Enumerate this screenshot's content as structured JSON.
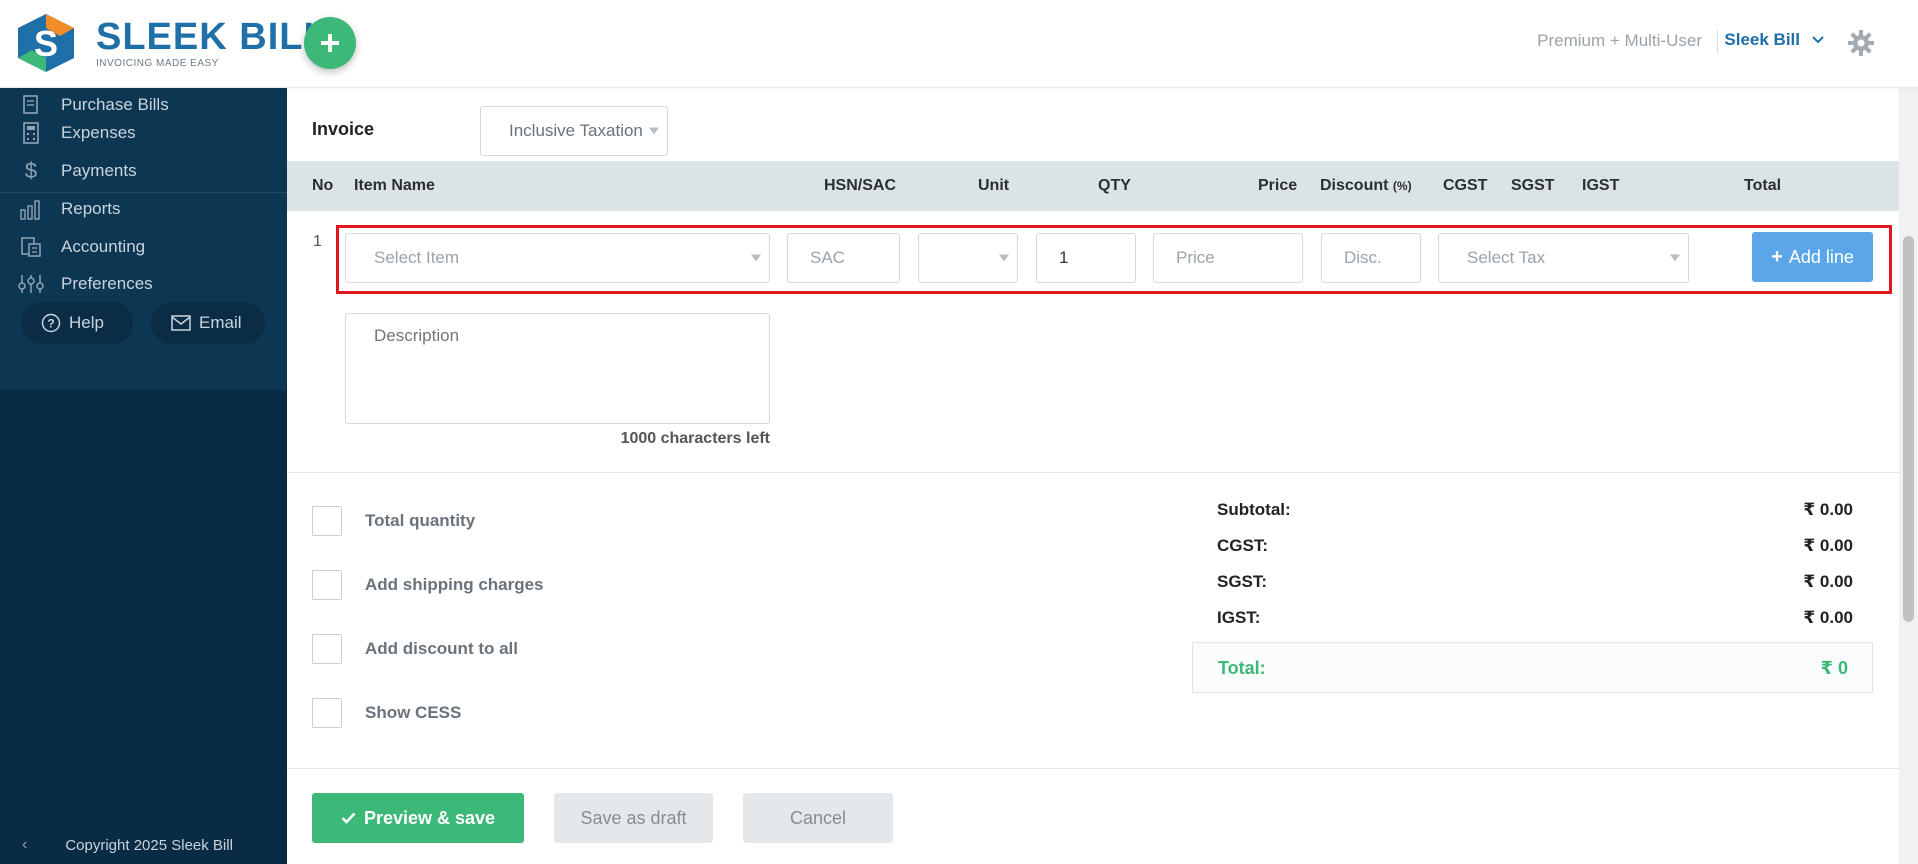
{
  "header": {
    "logo_title": "SLEEK BILL",
    "logo_subtitle": "INVOICING MADE EASY",
    "add_icon": "plus-icon",
    "plan": "Premium + Multi-User",
    "user": "Sleek Bill",
    "settings_icon": "gear-icon"
  },
  "sidebar": {
    "items": [
      {
        "label": "Purchase Bills",
        "icon": "purchase-bills-icon"
      },
      {
        "label": "Expenses",
        "icon": "calculator-icon"
      },
      {
        "label": "Payments",
        "icon": "dollar-icon"
      },
      {
        "label": "Reports",
        "icon": "bar-chart-icon"
      },
      {
        "label": "Accounting",
        "icon": "accounting-icon"
      },
      {
        "label": "Preferences",
        "icon": "sliders-icon"
      }
    ],
    "help_label": "Help",
    "email_label": "Email",
    "copyright": "Copyright 2025 Sleek Bill"
  },
  "invoice": {
    "label": "Invoice",
    "taxation": "Inclusive Taxation"
  },
  "table": {
    "columns": {
      "no": "No",
      "item_name": "Item Name",
      "hsn": "HSN/SAC",
      "unit": "Unit",
      "qty": "QTY",
      "price": "Price",
      "discount": "Discount",
      "discount_unit": "(%)",
      "cgst": "CGST",
      "sgst": "SGST",
      "igst": "IGST",
      "total": "Total"
    },
    "row": {
      "no": "1",
      "item_placeholder": "Select Item",
      "sac_placeholder": "SAC",
      "qty_value": "1",
      "price_placeholder": "Price",
      "disc_placeholder": "Disc.",
      "tax_placeholder": "Select Tax",
      "add_line": "Add line",
      "description_placeholder": "Description",
      "chars_left": "1000 characters left"
    }
  },
  "options": [
    {
      "label": "Total quantity"
    },
    {
      "label": "Add shipping charges"
    },
    {
      "label": "Add discount to all"
    },
    {
      "label": "Show CESS"
    }
  ],
  "summary": {
    "subtotal_label": "Subtotal:",
    "subtotal_value": "₹ 0.00",
    "cgst_label": "CGST:",
    "cgst_value": "₹ 0.00",
    "sgst_label": "SGST:",
    "sgst_value": "₹ 0.00",
    "igst_label": "IGST:",
    "igst_value": "₹ 0.00",
    "total_label": "Total:",
    "total_value": "₹ 0"
  },
  "footer": {
    "preview_save": "Preview & save",
    "save_draft": "Save as draft",
    "cancel": "Cancel"
  },
  "colors": {
    "brand_green": "#3cb878",
    "brand_blue": "#1f6fa8",
    "sidebar_bg": "#092b44",
    "highlight_red": "#e0161e",
    "add_line_blue": "#5aa6e8"
  }
}
